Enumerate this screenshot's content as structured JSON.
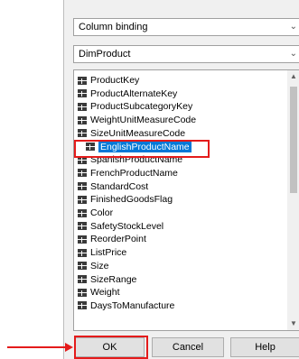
{
  "dialog": {
    "binding_type": "Column binding",
    "table": "DimProduct"
  },
  "columns": [
    "ProductKey",
    "ProductAlternateKey",
    "ProductSubcategoryKey",
    "WeightUnitMeasureCode",
    "SizeUnitMeasureCode",
    "EnglishProductName",
    "SpanishProductName",
    "FrenchProductName",
    "StandardCost",
    "FinishedGoodsFlag",
    "Color",
    "SafetyStockLevel",
    "ReorderPoint",
    "ListPrice",
    "Size",
    "SizeRange",
    "Weight",
    "DaysToManufacture"
  ],
  "selected_column": "EnglishProductName",
  "buttons": {
    "ok": "OK",
    "cancel": "Cancel",
    "help": "Help"
  },
  "colors": {
    "selection": "#0078d7",
    "annotation": "#e41b1b"
  }
}
